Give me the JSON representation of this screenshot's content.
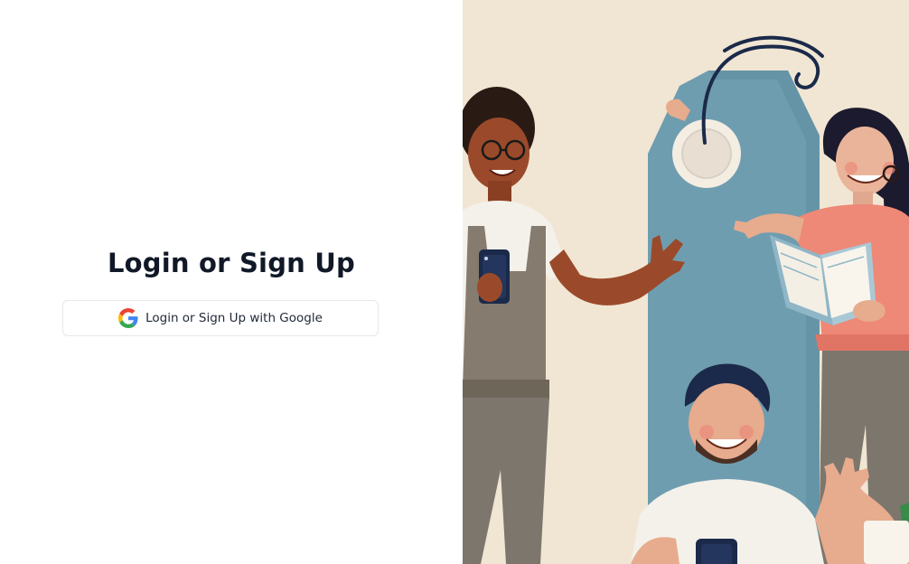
{
  "auth": {
    "title": "Login or Sign Up",
    "google_button_label": "Login or Sign Up with Google"
  },
  "icons": {
    "google": "google-g-icon"
  },
  "colors": {
    "background": "#ffffff",
    "title_text": "#111827",
    "button_border": "#e5e7eb",
    "illustration_bg": "#eee2cf",
    "tag_blue": "#6f9db0",
    "google_blue": "#4285F4",
    "google_red": "#EA4335",
    "google_yellow": "#FBBC05",
    "google_green": "#34A853"
  }
}
